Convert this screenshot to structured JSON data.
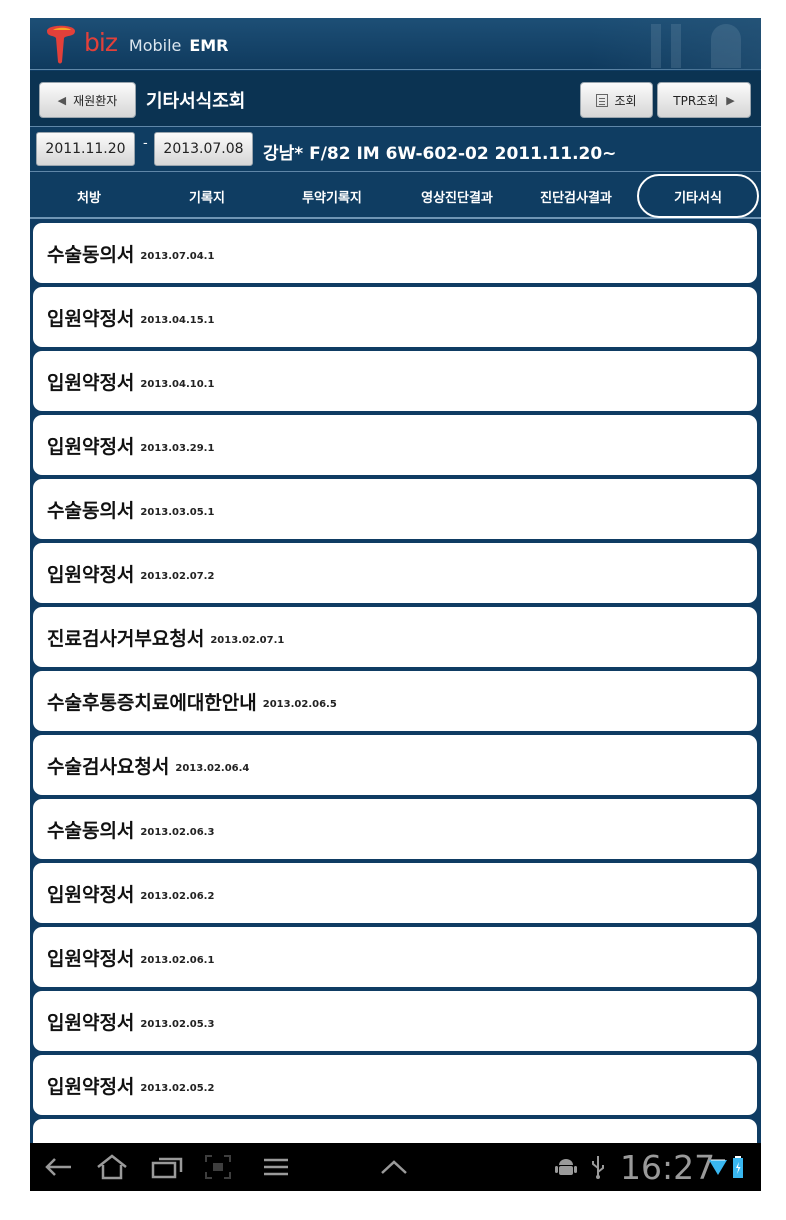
{
  "header": {
    "brand_biz": "biz",
    "brand_mobile": "Mobile",
    "brand_emr": "EMR"
  },
  "toolbar": {
    "back_label": "재원환자",
    "title": "기타서식조회",
    "query_label": "조회",
    "tpr_label": "TPR조회"
  },
  "date_row": {
    "from": "2011.11.20",
    "separator": "-",
    "to": "2013.07.08",
    "patient": "강남* F/82 IM 6W-602-02 2011.11.20~"
  },
  "tabs": [
    {
      "label": "처방",
      "active": false
    },
    {
      "label": "기록지",
      "active": false
    },
    {
      "label": "투약기록지",
      "active": false
    },
    {
      "label": "영상진단결과",
      "active": false
    },
    {
      "label": "진단검사결과",
      "active": false
    },
    {
      "label": "기타서식",
      "active": true
    }
  ],
  "list": {
    "items": [
      {
        "title": "수술동의서",
        "date": "2013.07.04.1"
      },
      {
        "title": "입원약정서",
        "date": "2013.04.15.1"
      },
      {
        "title": "입원약정서",
        "date": "2013.04.10.1"
      },
      {
        "title": "입원약정서",
        "date": "2013.03.29.1"
      },
      {
        "title": "수술동의서",
        "date": "2013.03.05.1"
      },
      {
        "title": "입원약정서",
        "date": "2013.02.07.2"
      },
      {
        "title": "진료검사거부요청서",
        "date": "2013.02.07.1"
      },
      {
        "title": "수술후통증치료에대한안내",
        "date": "2013.02.06.5"
      },
      {
        "title": "수술검사요청서",
        "date": "2013.02.06.4"
      },
      {
        "title": "수술동의서",
        "date": "2013.02.06.3"
      },
      {
        "title": "입원약정서",
        "date": "2013.02.06.2"
      },
      {
        "title": "입원약정서",
        "date": "2013.02.06.1"
      },
      {
        "title": "입원약정서",
        "date": "2013.02.05.3"
      },
      {
        "title": "입원약정서",
        "date": "2013.02.05.2"
      },
      {
        "title": "",
        "date": ""
      }
    ]
  },
  "navbar": {
    "time": "16:27",
    "icons": [
      "back-icon",
      "home-icon",
      "recent-apps-icon",
      "screenshot-icon",
      "menu-icon",
      "chevron-up-icon",
      "android-icon",
      "usb-icon",
      "wifi-icon",
      "battery-icon"
    ]
  },
  "colors": {
    "background": "#0f3c63",
    "brand_red": "#e2403a",
    "list_item": "#ffffff"
  }
}
